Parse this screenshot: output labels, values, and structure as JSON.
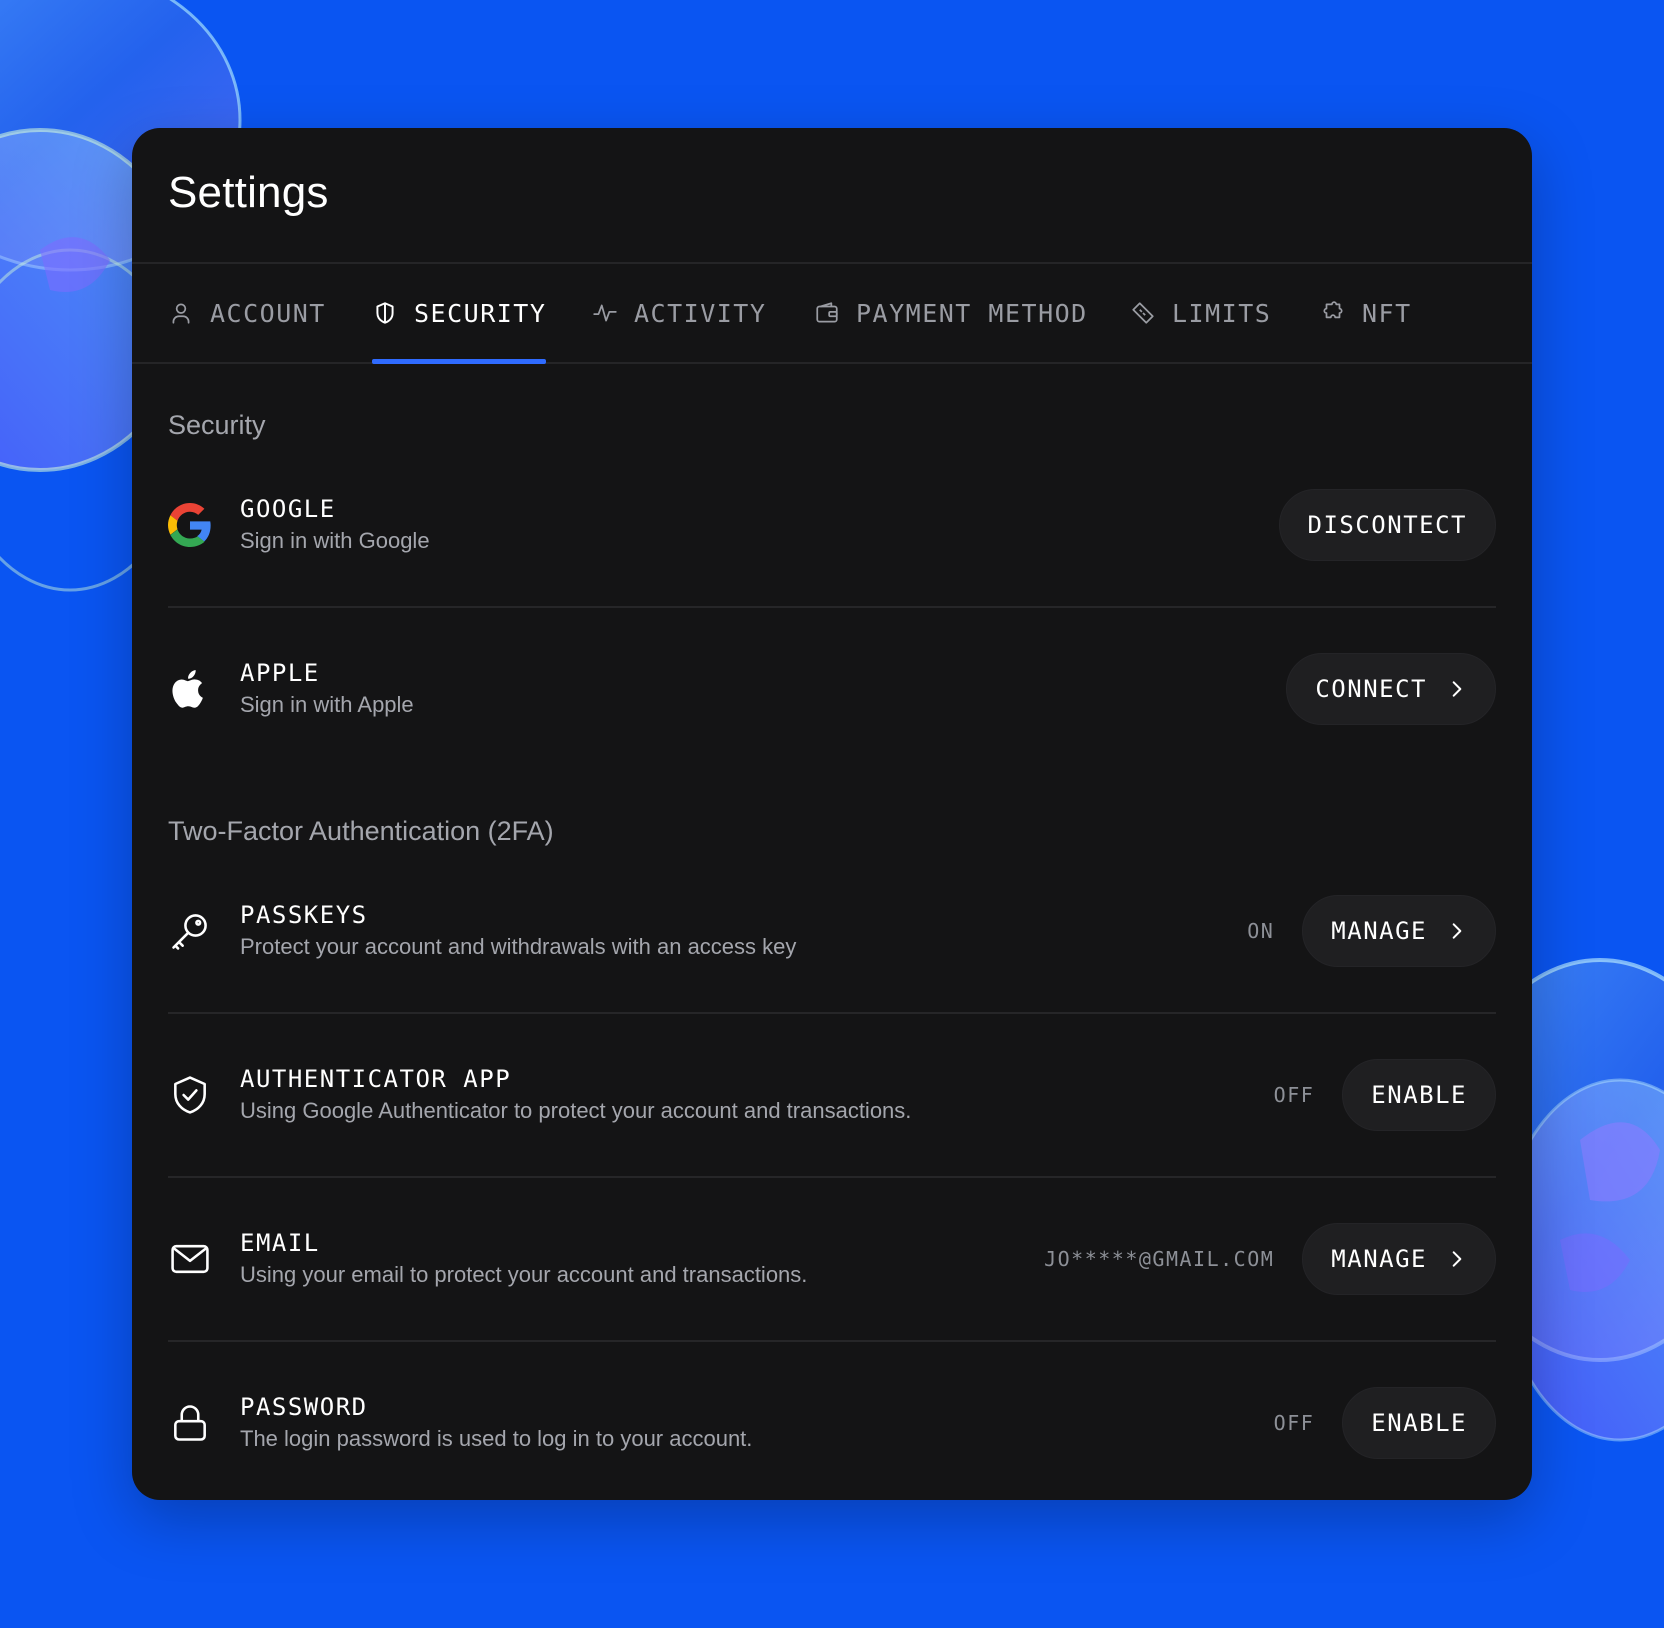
{
  "app": {
    "title": "Settings"
  },
  "tabs": [
    {
      "label": "ACCOUNT",
      "icon": "user-icon"
    },
    {
      "label": "SECURITY",
      "icon": "shield-icon",
      "active": true
    },
    {
      "label": "ACTIVITY",
      "icon": "activity-icon"
    },
    {
      "label": "PAYMENT METHOD",
      "icon": "wallet-icon"
    },
    {
      "label": "LIMITS",
      "icon": "tag-icon"
    },
    {
      "label": "NFT",
      "icon": "puzzle-icon"
    }
  ],
  "security": {
    "title": "Security",
    "rows": [
      {
        "icon": "google-icon",
        "title": "GOOGLE",
        "subtitle": "Sign in with Google",
        "button": "DISCONTECT"
      },
      {
        "icon": "apple-icon",
        "title": "APPLE",
        "subtitle": "Sign in with Apple",
        "button": "CONNECT"
      }
    ]
  },
  "twofa": {
    "title": "Two-Factor Authentication (2FA)",
    "rows": [
      {
        "icon": "key-icon",
        "title": "PASSKEYS",
        "subtitle": "Protect your account and withdrawals with an access key",
        "status": "ON",
        "button": "MANAGE"
      },
      {
        "icon": "shield-check-icon",
        "title": "AUTHENTICATOR APP",
        "subtitle": "Using Google Authenticator to protect your account and transactions.",
        "status": "OFF",
        "button": "ENABLE"
      },
      {
        "icon": "mail-icon",
        "title": "EMAIL",
        "subtitle": "Using your email to protect your account and transactions.",
        "status": "JO*****@GMAIL.COM",
        "button": "MANAGE"
      },
      {
        "icon": "lock-icon",
        "title": "PASSWORD",
        "subtitle": "The login password is used to log in to your account.",
        "status": "OFF",
        "button": "ENABLE"
      }
    ]
  },
  "colors": {
    "background": "#0a55f2",
    "panel": "#141415",
    "accent": "#2f6bff",
    "button": "#1f1f21"
  }
}
